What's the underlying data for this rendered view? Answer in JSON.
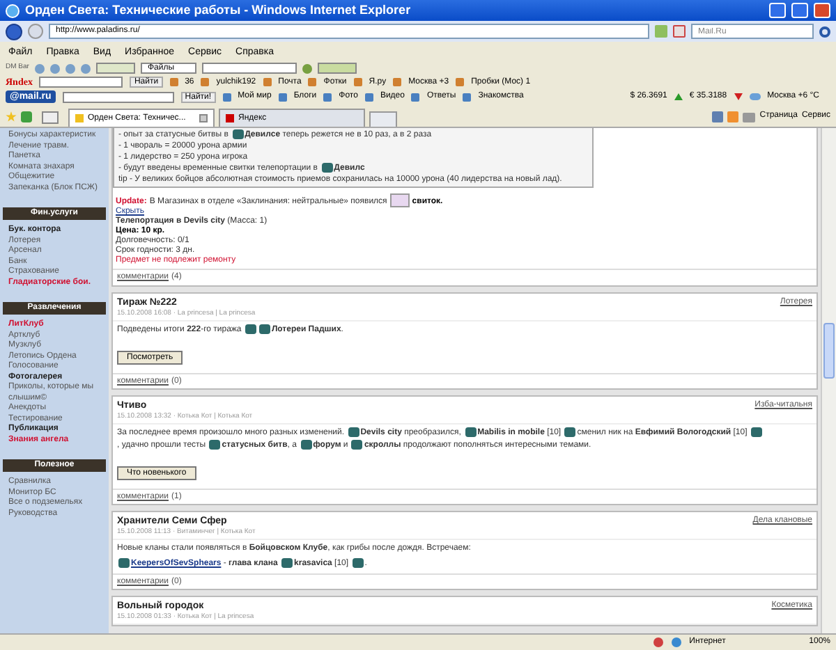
{
  "window": {
    "title": "Орден Света: Технические работы - Windows Internet Explorer"
  },
  "address": {
    "url": "http://www.paladins.ru/"
  },
  "search": {
    "placeholder": "Mail.Ru"
  },
  "menu": [
    "Файл",
    "Правка",
    "Вид",
    "Избранное",
    "Сервис",
    "Справка"
  ],
  "dm_bar": {
    "label": "DM Bar",
    "files": "Файлы"
  },
  "yandex_bar": {
    "logo": "Яndex",
    "button": "Найти",
    "items": [
      "36",
      "yulchik192",
      "Почта",
      "Фотки",
      "Я.ру",
      "Москва +3",
      "Пробки (Мос) 1"
    ]
  },
  "mail_bar": {
    "logo": "@mail.ru",
    "button": "Найти!",
    "items": [
      "Мой мир",
      "Блоги",
      "Фото",
      "Видео",
      "Ответы",
      "Знакомства"
    ],
    "rates": [
      {
        "text": "$ 26.3691",
        "kind": "up"
      },
      {
        "text": "€ 35.3188",
        "kind": "down"
      }
    ],
    "weather": "Москва +6 °С"
  },
  "tabs": [
    {
      "label": "Орден Света: Техничес...",
      "selected": true
    },
    {
      "label": "Яндекс",
      "selected": false
    }
  ],
  "command_bar": [
    "Страница",
    "Сервис"
  ],
  "sidebar": {
    "top_items": [
      {
        "label": "Бонусы характеристик",
        "kind": "normal"
      },
      {
        "label": "Лечение травм. Панетка",
        "kind": "normal"
      },
      {
        "label": "Комната знахаря",
        "kind": "normal"
      },
      {
        "label": "Общежитие",
        "kind": "normal"
      },
      {
        "label": "Запеканка (Блок ПСЖ)",
        "kind": "normal"
      }
    ],
    "sections": [
      {
        "title": "Фин.услуги",
        "items": [
          {
            "label": "Бук. контора",
            "kind": "bold"
          },
          {
            "label": "Лотерея",
            "kind": "normal"
          },
          {
            "label": "Арсенал",
            "kind": "normal"
          },
          {
            "label": "Банк",
            "kind": "normal"
          },
          {
            "label": "Страхование",
            "kind": "normal"
          },
          {
            "label": "Гладиаторские бои.",
            "kind": "highlight"
          }
        ]
      },
      {
        "title": "Развлечения",
        "items": [
          {
            "label": "ЛитКлуб",
            "kind": "highlight"
          },
          {
            "label": "Артклуб",
            "kind": "normal"
          },
          {
            "label": "Музклуб",
            "kind": "normal"
          },
          {
            "label": "Летопись Ордена",
            "kind": "normal"
          },
          {
            "label": "Голосование",
            "kind": "normal"
          },
          {
            "label": "Фотогалерея",
            "kind": "bold"
          },
          {
            "label": "Приколы, которые мы слышим©",
            "kind": "normal"
          },
          {
            "label": "Анекдоты",
            "kind": "normal"
          },
          {
            "label": "Тестирование",
            "kind": "normal"
          },
          {
            "label": "Публикация",
            "kind": "bold"
          },
          {
            "label": "Знания ангела",
            "kind": "highlight"
          }
        ]
      },
      {
        "title": "Полезное",
        "items": [
          {
            "label": "Сравнилка",
            "kind": "normal"
          },
          {
            "label": "Монитор БС",
            "kind": "normal"
          },
          {
            "label": "Все о подземельях",
            "kind": "normal"
          },
          {
            "label": "Руководства",
            "kind": "normal"
          }
        ]
      }
    ]
  },
  "first_post": {
    "box_lines": [
      [
        {
          "kind": "text",
          "text": "- опыт за статусные битвы в"
        },
        {
          "kind": "icon"
        },
        {
          "kind": "text",
          "text": "**Девилсе** теперь режется не в 10 раз, а в 2 раза"
        }
      ],
      [
        {
          "kind": "text",
          "text": "- 1 чвораль = 20000 урона армии"
        }
      ],
      [
        {
          "kind": "text",
          "text": "- 1 лидерство = 250 урона игрока"
        }
      ],
      [
        {
          "kind": "text",
          "text": "- будут введены временные свитки телепортации в"
        },
        {
          "kind": "icon"
        },
        {
          "kind": "text",
          "text": "**Девилс**"
        }
      ],
      [
        {
          "kind": "text",
          "text": "tip - У великих бойцов абсолютная стоимость приемов сохранилась на 10000 урона (40 лидерства на новый лад)."
        }
      ]
    ],
    "update_label": "Update:",
    "update_text": "В Магазинах в отделе «Заклинания: нейтральные» появился",
    "update_item": "свиток.",
    "hide_link": "Скрыть",
    "item_lines": [
      {
        "text": "**Телепортация в Devils city** (Масса: 1)",
        "kind": "normal"
      },
      {
        "text": "Цена: 10 кр.",
        "kind": "bold"
      },
      {
        "text": "Долговечность: 0/1",
        "kind": "normal"
      },
      {
        "text": "Срок годности: 3 дн.",
        "kind": "normal"
      },
      {
        "text": "Предмет не подлежит ремонту",
        "kind": "warning"
      }
    ],
    "comments_link": "комментарии",
    "comments_count": "(4)"
  },
  "posts": [
    {
      "title": "Тираж №222",
      "meta": "15.10.2008 16:08 · La princesa | La princesa",
      "category": "Лотерея",
      "paragraphs": [
        [
          {
            "kind": "text",
            "text": "Подведены итоги **222**-го тиража"
          },
          {
            "kind": "icon"
          },
          {
            "kind": "icon"
          },
          {
            "kind": "text",
            "text": "**Лотереи Падших**."
          }
        ]
      ],
      "button": "Посмотреть",
      "comments_link": "комментарии",
      "comments_count": "(0)"
    },
    {
      "title": "Чтиво",
      "meta": "15.10.2008 13:32 · Котька Кот | Котька Кот",
      "category": "Изба-читальня",
      "paragraphs": [
        [
          {
            "kind": "text",
            "text": "За последнее время произошло много разных изменений."
          },
          {
            "kind": "icon"
          },
          {
            "kind": "text",
            "text": "**Devils city** преобразился,"
          },
          {
            "kind": "icon"
          },
          {
            "kind": "text",
            "text": "**Mabilis in mobile** [10]"
          },
          {
            "kind": "icon"
          },
          {
            "kind": "text",
            "text": "сменил ник на **Евфимий Вологодский** [10]"
          },
          {
            "kind": "icon"
          },
          {
            "kind": "text",
            "text": ", удачно прошли тесты"
          },
          {
            "kind": "icon"
          },
          {
            "kind": "text",
            "text": "**статусных битв**, а"
          },
          {
            "kind": "icon"
          },
          {
            "kind": "text",
            "text": "**форум** и"
          },
          {
            "kind": "icon"
          },
          {
            "kind": "text",
            "text": "**скроллы** продолжают пополняться интересными темами."
          }
        ]
      ],
      "button": "Что новенького",
      "comments_link": "комментарии",
      "comments_count": "(1)"
    },
    {
      "title": "Хранители Семи Сфер",
      "meta": "15.10.2008 11:13 · Витаминчег | Котька Кот",
      "category": "Дела клановые",
      "paragraphs": [
        [
          {
            "kind": "text",
            "text": "Новые кланы стали появляться в **Бойцовском Клубе**, как грибы после дождя. Встречаем:"
          }
        ],
        [
          {
            "kind": "icon"
          },
          {
            "kind": "link",
            "text": "KeepersOfSevSphears"
          },
          {
            "kind": "text",
            "text": "- **глава клана**"
          },
          {
            "kind": "icon"
          },
          {
            "kind": "text",
            "text": "**krasavica** [10]"
          },
          {
            "kind": "icon"
          },
          {
            "kind": "text",
            "text": "."
          }
        ]
      ],
      "comments_link": "комментарии",
      "comments_count": "(0)"
    },
    {
      "title": "Вольный городок",
      "meta": "15.10.2008 01:33 · Котька Кот | La princesa",
      "category": "Косметика"
    }
  ],
  "status_bar": {
    "zone": "Интернет",
    "zoom": "100%"
  }
}
